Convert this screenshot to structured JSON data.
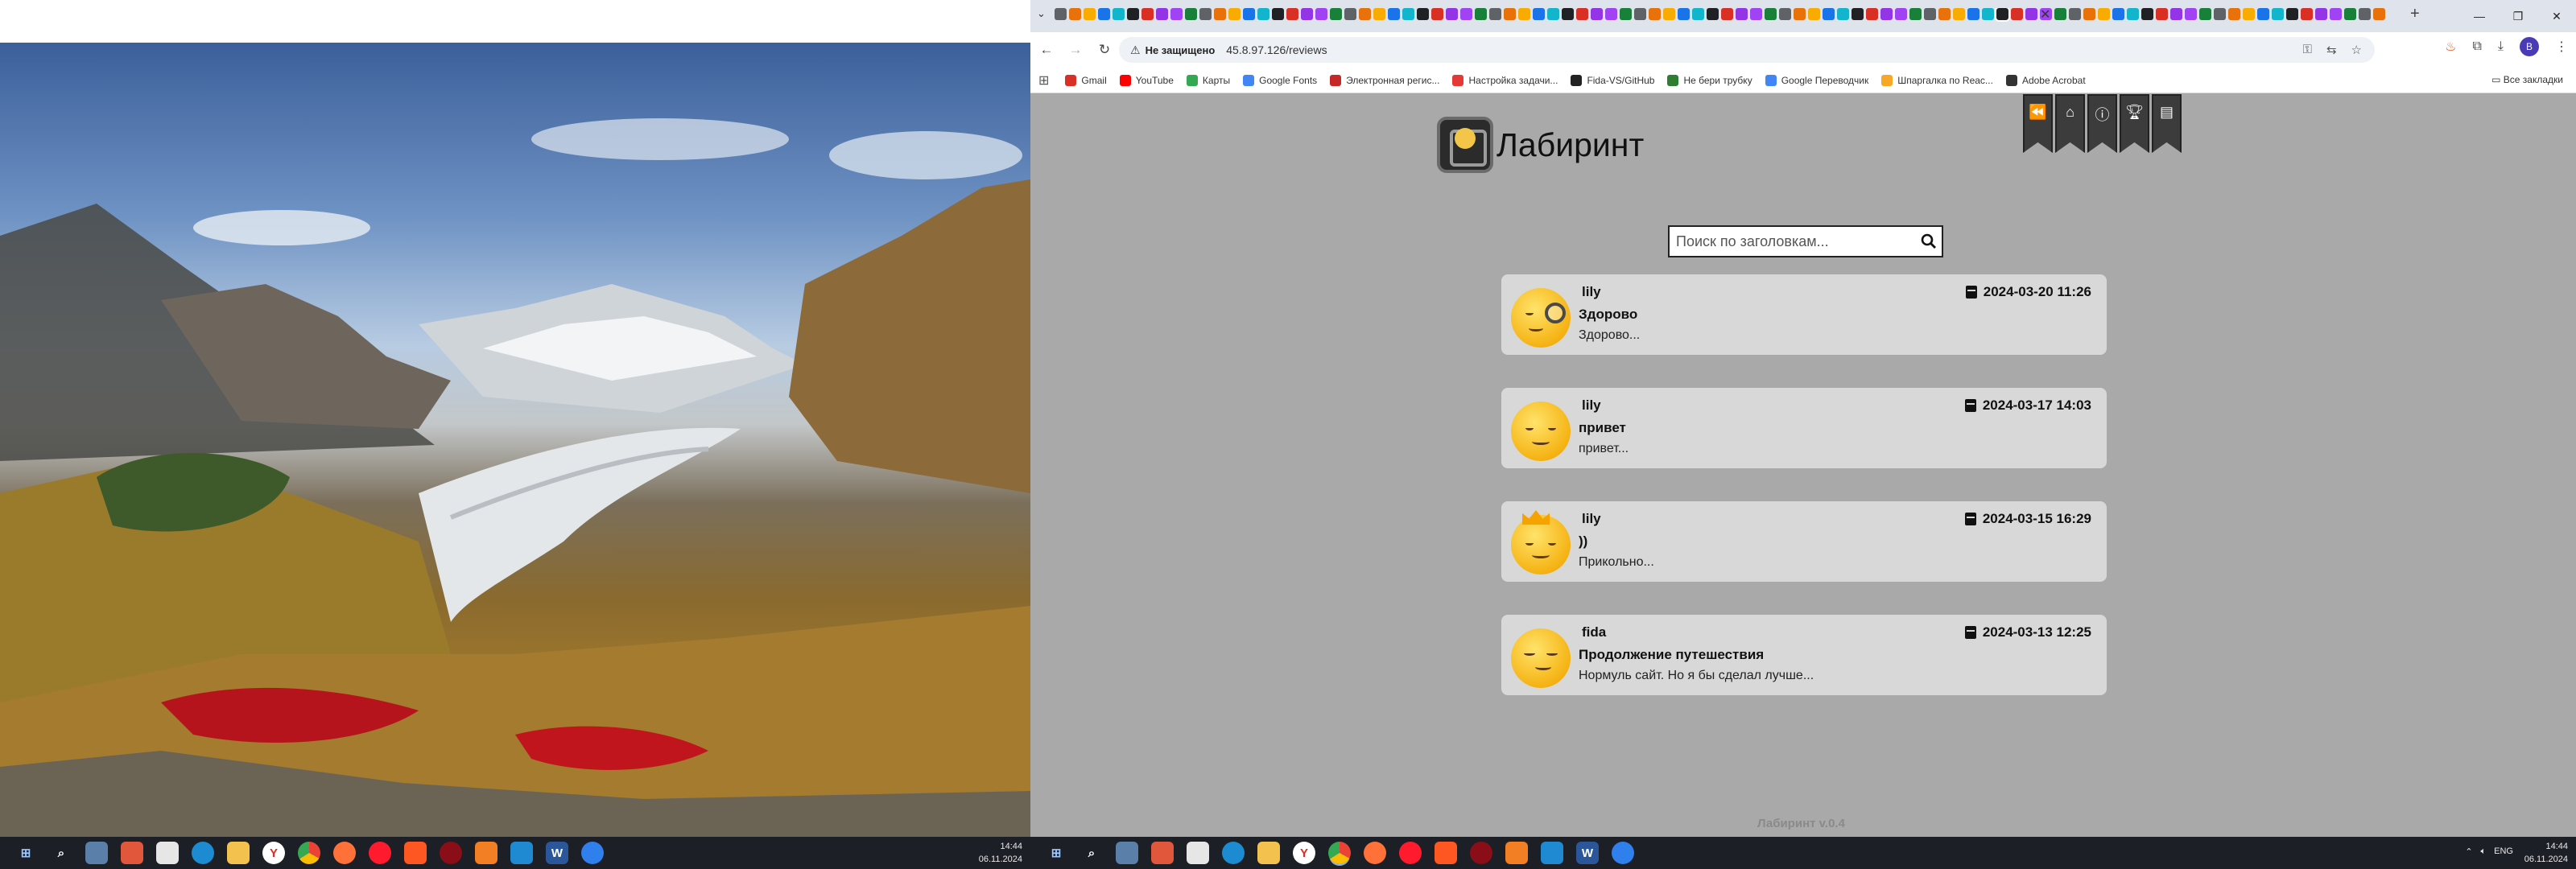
{
  "browser": {
    "tab_close_glyph": "✕",
    "new_tab_glyph": "+",
    "security_label": "Не защищено",
    "url": "45.8.97.126/reviews",
    "window_controls": [
      "—",
      "❐",
      "✕"
    ],
    "profile_initial": "B",
    "bookmarks": [
      {
        "label": "Gmail",
        "color": "#d93025"
      },
      {
        "label": "YouTube",
        "color": "#ff0000"
      },
      {
        "label": "Карты",
        "color": "#34a853"
      },
      {
        "label": "Google Fonts",
        "color": "#4285f4"
      },
      {
        "label": "Электронная регис...",
        "color": "#c62828"
      },
      {
        "label": "Настройка задачи...",
        "color": "#e53935"
      },
      {
        "label": "Fida-VS/GitHub",
        "color": "#222222"
      },
      {
        "label": "Не бери трубку",
        "color": "#2e7d32"
      },
      {
        "label": "Google Переводчик",
        "color": "#4285f4"
      },
      {
        "label": "Шпаргалка по Reac...",
        "color": "#f9a825"
      },
      {
        "label": "Adobe Acrobat",
        "color": "#333333"
      }
    ],
    "all_bookmarks": "Все закладки"
  },
  "page": {
    "logo_text": "Лабиринт",
    "nav_icons": [
      "back-icon",
      "home-icon",
      "info-icon",
      "trophy-icon",
      "document-icon"
    ],
    "search_placeholder": "Поиск по заголовкам...",
    "reviews": [
      {
        "author": "lily",
        "title": "Здорово",
        "preview": "Здорово...",
        "date": "2024-03-20 11:26",
        "avatar": "monocle"
      },
      {
        "author": "lily",
        "title": "привет",
        "preview": "привет...",
        "date": "2024-03-17 14:03",
        "avatar": "smile"
      },
      {
        "author": "lily",
        "title": "))",
        "preview": "Прикольно...",
        "date": "2024-03-15 16:29",
        "avatar": "crown"
      },
      {
        "author": "fida",
        "title": "Продолжение путешествия",
        "preview": "Нормуль сайт. Но я бы сделал лучше...",
        "date": "2024-03-13 12:25",
        "avatar": "smirk"
      }
    ],
    "version": "Лабиринт v.0.4"
  },
  "taskbar": {
    "left_clock": {
      "time": "14:44",
      "date": "06.11.2024"
    },
    "right_clock": {
      "time": "14:44",
      "date": "06.11.2024"
    },
    "language": "ENG"
  }
}
